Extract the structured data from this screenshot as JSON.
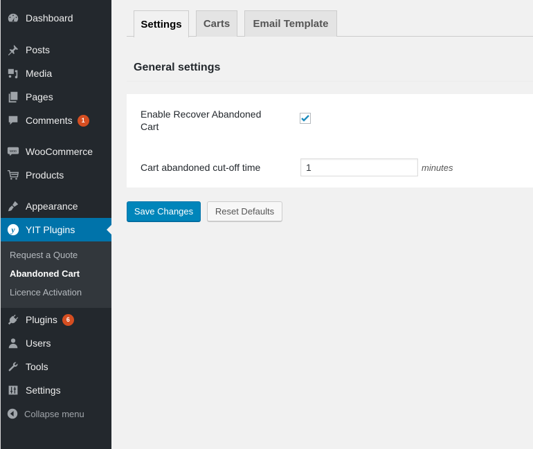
{
  "sidebar": {
    "items": [
      {
        "label": "Dashboard",
        "icon": "dashboard-icon"
      },
      {
        "label": "Posts",
        "icon": "pushpin-icon"
      },
      {
        "label": "Media",
        "icon": "media-icon"
      },
      {
        "label": "Pages",
        "icon": "pages-icon"
      },
      {
        "label": "Comments",
        "icon": "comment-icon",
        "badge": "1"
      },
      {
        "label": "WooCommerce",
        "icon": "woocommerce-icon"
      },
      {
        "label": "Products",
        "icon": "cart-icon"
      },
      {
        "label": "Appearance",
        "icon": "paintbrush-icon"
      },
      {
        "label": "YIT Plugins",
        "icon": "yit-icon",
        "active": true
      },
      {
        "label": "Plugins",
        "icon": "plug-icon",
        "badge": "6"
      },
      {
        "label": "Users",
        "icon": "user-icon"
      },
      {
        "label": "Tools",
        "icon": "wrench-icon"
      },
      {
        "label": "Settings",
        "icon": "sliders-icon"
      }
    ],
    "submenu": [
      {
        "label": "Request a Quote"
      },
      {
        "label": "Abandoned Cart",
        "current": true
      },
      {
        "label": "Licence Activation"
      }
    ],
    "collapse_label": "Collapse menu"
  },
  "tabs": [
    {
      "label": "Settings",
      "active": true
    },
    {
      "label": "Carts"
    },
    {
      "label": "Email Template"
    }
  ],
  "section_title": "General settings",
  "fields": {
    "enable_recover": {
      "label_line1": "Enable Recover Abandoned",
      "label_line2": "Cart",
      "checked": true
    },
    "cutoff": {
      "label": "Cart abandoned cut-off time",
      "value": "1",
      "unit": "minutes"
    }
  },
  "buttons": {
    "save": "Save Changes",
    "reset": "Reset Defaults"
  },
  "colors": {
    "accent": "#0073aa",
    "primary_button": "#0085ba",
    "badge": "#d54e21",
    "sidebar_bg": "#23282d"
  }
}
